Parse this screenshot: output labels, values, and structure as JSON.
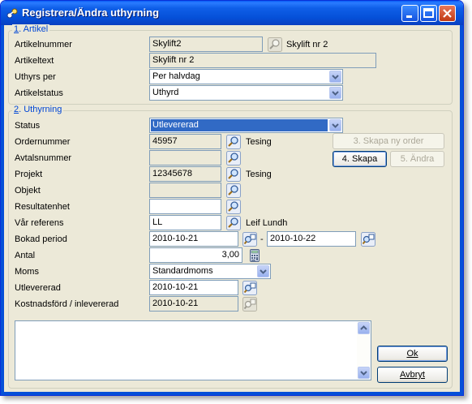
{
  "window": {
    "title": "Registrera/Ändra uthyrning"
  },
  "artikel": {
    "legend_num": "1",
    "legend_text": ". Artikel",
    "artikelnummer_label": "Artikelnummer",
    "artikelnummer_value": "Skylift2",
    "artikelnummer_desc": "Skylift nr 2",
    "artikeltext_label": "Artikeltext",
    "artikeltext_value": "Skylift nr 2",
    "uthyrs_per_label": "Uthyrs per",
    "uthyrs_per_value": "Per halvdag",
    "artikelstatus_label": "Artikelstatus",
    "artikelstatus_value": "Uthyrd"
  },
  "uthyrning": {
    "legend_num": "2",
    "legend_text": ". Uthyrning",
    "status_label": "Status",
    "status_value": "Utlevererad",
    "ordernummer_label": "Ordernummer",
    "ordernummer_value": "45957",
    "ordernummer_desc": "Tesing",
    "avtalsnummer_label": "Avtalsnummer",
    "avtalsnummer_value": "",
    "projekt_label": "Projekt",
    "projekt_value": "12345678",
    "projekt_desc": "Tesing",
    "objekt_label": "Objekt",
    "objekt_value": "",
    "resultatenhet_label": "Resultatenhet",
    "resultatenhet_value": "",
    "var_referens_label": "Vår referens",
    "var_referens_value": "LL",
    "var_referens_desc": "Leif Lundh",
    "bokad_period_label": "Bokad period",
    "bokad_from": "2010-10-21",
    "bokad_sep": "-",
    "bokad_to": "2010-10-22",
    "antal_label": "Antal",
    "antal_value": "3,00",
    "moms_label": "Moms",
    "moms_value": "Standardmoms",
    "utlevererad_label": "Utlevererad",
    "utlevererad_value": "2010-10-21",
    "kostnadsford_label": "Kostnadsförd / inlevererad",
    "kostnadsford_value": "2010-10-21"
  },
  "buttons": {
    "skapa_ny_order": "3. Skapa ny order",
    "skapa": "4. Skapa",
    "andra": "5. Ändra",
    "ok": "Ok",
    "avbryt": "Avbryt"
  },
  "colors": {
    "accent": "#0046d5",
    "selection": "#316ac5",
    "titlebar": "#0550d8"
  }
}
